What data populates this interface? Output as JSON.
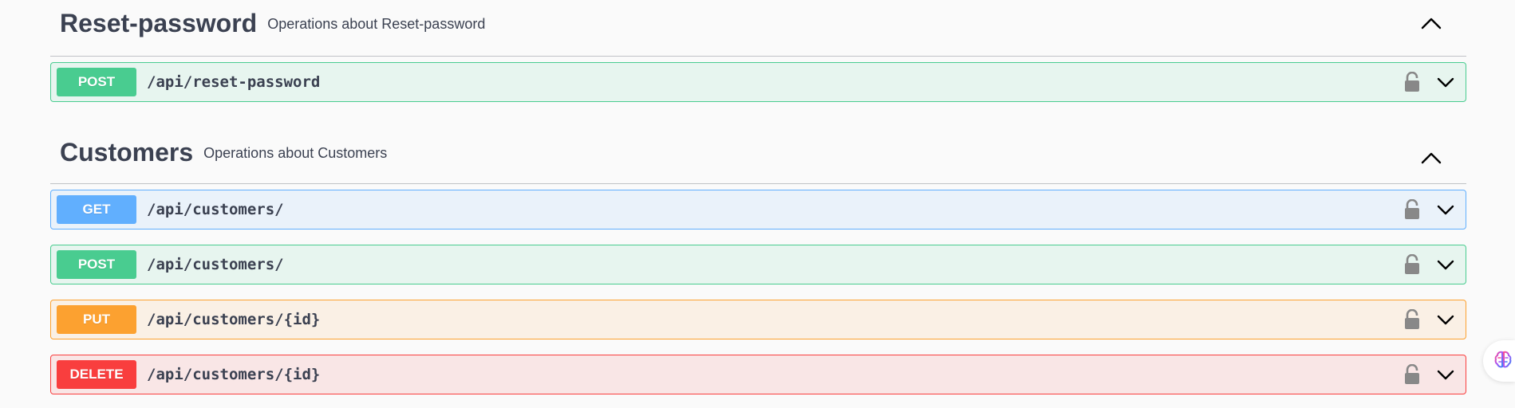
{
  "sections": [
    {
      "name": "Reset-password",
      "description": "Operations about Reset-password",
      "operations": [
        {
          "method": "POST",
          "path": "/api/reset-password"
        }
      ]
    },
    {
      "name": "Customers",
      "description": "Operations about Customers",
      "operations": [
        {
          "method": "GET",
          "path": "/api/customers/"
        },
        {
          "method": "POST",
          "path": "/api/customers/"
        },
        {
          "method": "PUT",
          "path": "/api/customers/{id}"
        },
        {
          "method": "DELETE",
          "path": "/api/customers/{id}"
        }
      ]
    }
  ],
  "icons": {
    "collapse": "chevron-up-icon",
    "expand": "chevron-down-icon",
    "auth": "lock-icon",
    "floating": "brain-icon"
  },
  "colors": {
    "post": "#49cc90",
    "get": "#61affe",
    "put": "#fca130",
    "delete": "#f93e3e",
    "text": "#3b4151"
  }
}
